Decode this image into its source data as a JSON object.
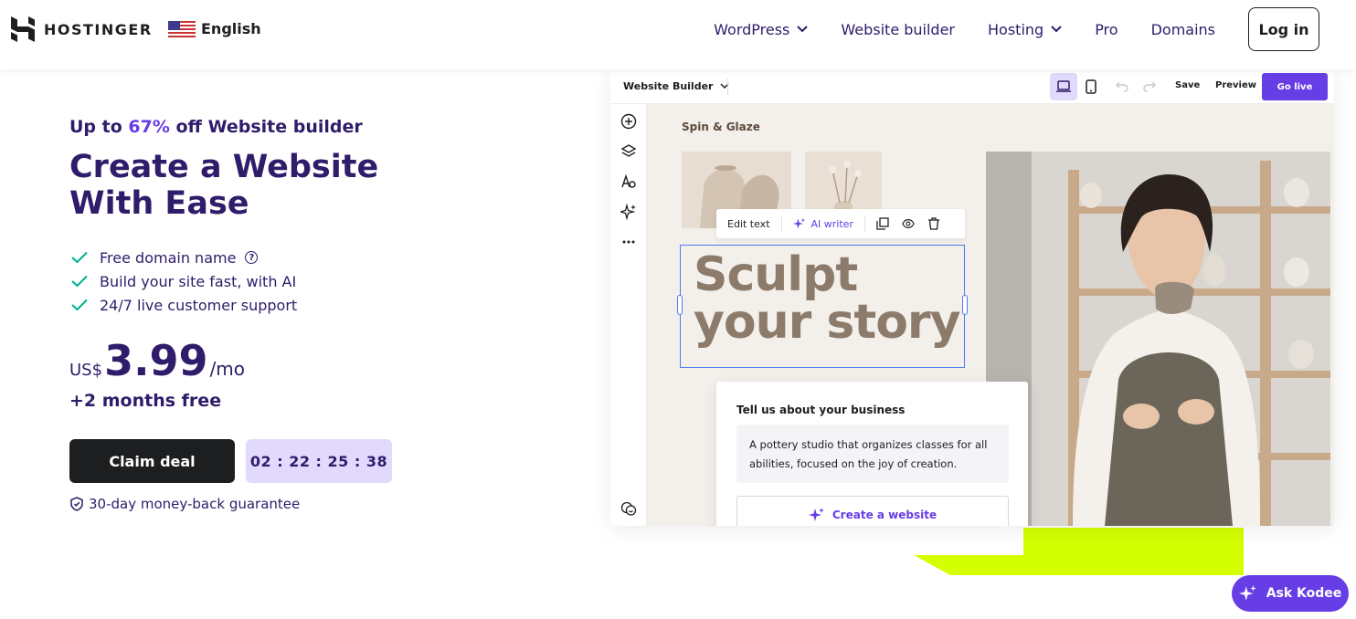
{
  "nav": {
    "brand": "HOSTINGER",
    "language": "English",
    "items": [
      {
        "label": "WordPress",
        "dropdown": true
      },
      {
        "label": "Website builder",
        "dropdown": false
      },
      {
        "label": "Hosting",
        "dropdown": true
      },
      {
        "label": "Pro",
        "dropdown": false
      },
      {
        "label": "Domains",
        "dropdown": false
      }
    ],
    "login": "Log in"
  },
  "hero": {
    "promo_prefix": "Up to ",
    "promo_pct": "67%",
    "promo_suffix": " off Website builder",
    "headline": "Create a Website With Ease",
    "features": [
      "Free domain name",
      "Build your site fast, with AI",
      "24/7 live customer support"
    ],
    "currency": "US$",
    "price": "3.99",
    "period": "/mo",
    "bonus": "+2 months free",
    "cta": "Claim deal",
    "timer": "02 : 22 : 25 : 38",
    "guarantee": "30-day money-back guarantee"
  },
  "builder": {
    "menu_label": "Website Builder",
    "save": "Save",
    "preview": "Preview",
    "go_live": "Go live",
    "site_name": "Spin & Glaze",
    "toolbar": {
      "edit_text": "Edit text",
      "ai_writer": "AI writer"
    },
    "heading_line1": "Sculpt",
    "heading_line2": "your story",
    "card": {
      "question": "Tell us about your business",
      "textarea": "A pottery studio that organizes classes for all abilities, focused on the joy of creation.",
      "button": "Create a website"
    }
  },
  "assistant": {
    "label": "Ask Kodee"
  },
  "colors": {
    "brand_purple": "#673de6",
    "navy": "#2f1c6a",
    "lime": "#d4ff00",
    "check_teal": "#00b090"
  }
}
